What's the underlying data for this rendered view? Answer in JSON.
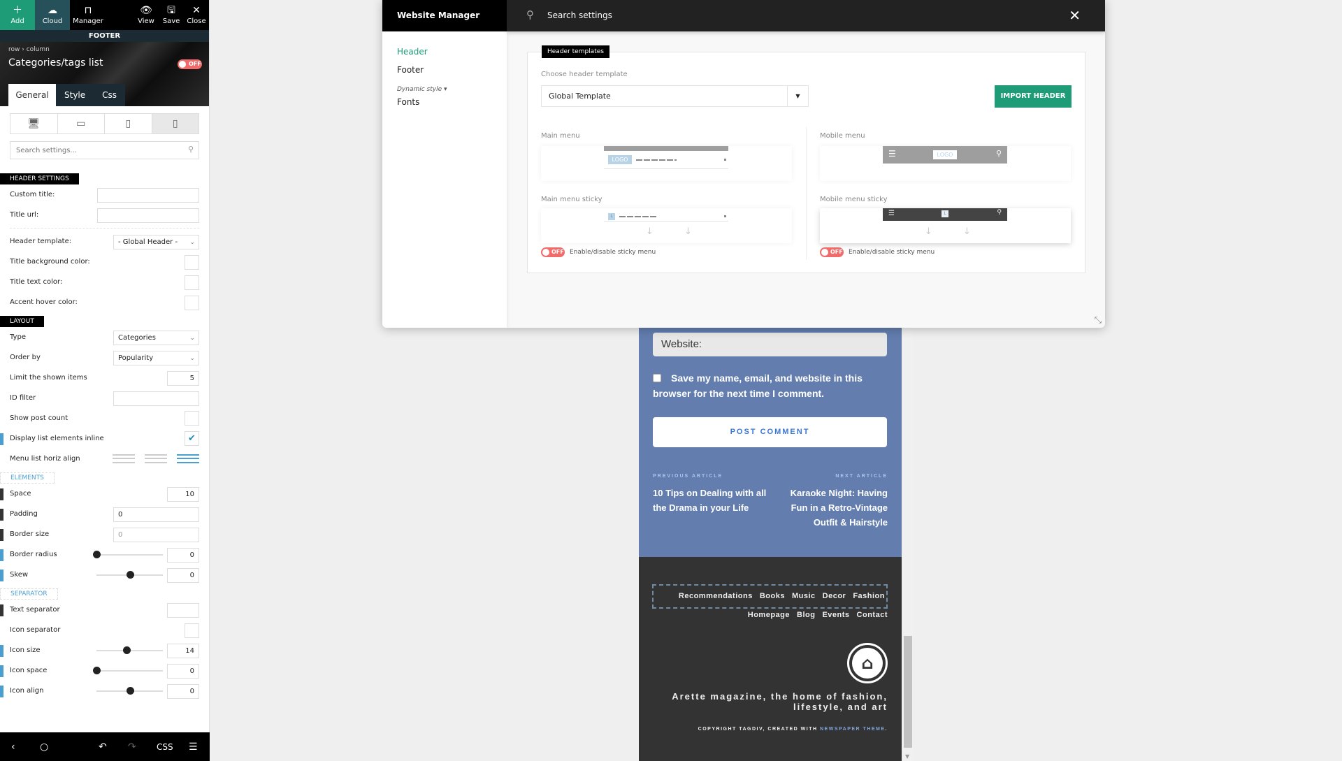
{
  "sidebar": {
    "toolbar": {
      "add": "Add",
      "cloud": "Cloud",
      "manager": "Manager",
      "view": "View",
      "save": "Save",
      "close": "Close"
    },
    "section_bar": "FOOTER",
    "breadcrumb": [
      "row",
      "column"
    ],
    "element_title": "Categories/tags list",
    "toggle_state": "OFF",
    "tabs": [
      "General",
      "Style",
      "Css"
    ],
    "active_tab": "General",
    "devices": [
      "desktop",
      "landscape-tablet",
      "portrait-tablet",
      "phone"
    ],
    "active_device": "phone",
    "search_placeholder": "Search settings...",
    "header_settings": {
      "title": "HEADER SETTINGS",
      "custom_title_label": "Custom title:",
      "custom_title_value": "",
      "title_url_label": "Title url:",
      "title_url_value": "",
      "header_template_label": "Header template:",
      "header_template_value": "- Global Header -",
      "title_bg_color_label": "Title background color:",
      "title_text_color_label": "Title text color:",
      "accent_hover_color_label": "Accent hover color:"
    },
    "layout": {
      "title": "LAYOUT",
      "type_label": "Type",
      "type_value": "Categories",
      "order_label": "Order by",
      "order_value": "Popularity",
      "limit_label": "Limit the shown items",
      "limit_value": "5",
      "id_filter_label": "ID filter",
      "id_filter_value": "",
      "post_count_label": "Show post count",
      "post_count_checked": false,
      "inline_label": "Display list elements inline",
      "inline_checked": true,
      "align_label": "Menu list horiz align",
      "align_value": "right"
    },
    "elements": {
      "title": "ELEMENTS",
      "space_label": "Space",
      "space_value": "10",
      "padding_label": "Padding",
      "padding_value": "0",
      "border_size_label": "Border size",
      "border_size_placeholder": "0",
      "border_radius_label": "Border radius",
      "border_radius_value": "0",
      "border_radius_slider": 0.0,
      "skew_label": "Skew",
      "skew_value": "0",
      "skew_slider": 0.5
    },
    "separator": {
      "title": "SEPARATOR",
      "text_sep_label": "Text separator",
      "text_sep_value": "",
      "icon_sep_label": "Icon separator",
      "icon_size_label": "Icon size",
      "icon_size_value": "14",
      "icon_size_slider": 0.45,
      "icon_space_label": "Icon space",
      "icon_space_value": "0",
      "icon_space_slider": 0.0,
      "icon_align_label": "Icon align",
      "icon_align_value": "0",
      "icon_align_slider": 0.5
    },
    "bottom_bar": {
      "css_label": "CSS"
    }
  },
  "modal": {
    "brand": "Website Manager",
    "search_placeholder": "Search settings",
    "nav": {
      "header": "Header",
      "footer": "Footer",
      "dynamic_style": "Dynamic style",
      "fonts": "Fonts"
    },
    "panel_tag": "Header templates",
    "choose_label": "Choose header template",
    "template_value": "Global Template",
    "import_button": "IMPORT HEADER",
    "main_menu_label": "Main menu",
    "mobile_menu_label": "Mobile menu",
    "main_sticky_label": "Main menu sticky",
    "mobile_sticky_label": "Mobile menu sticky",
    "logo_text": "LOGO",
    "logo_short": "L",
    "sticky_toggle_state": "OFF",
    "sticky_toggle_label": "Enable/disable sticky menu"
  },
  "preview": {
    "website_placeholder": "Website:",
    "save_info_text": "Save my name, email, and website in this browser for the next time I comment.",
    "post_comment": "POST COMMENT",
    "previous_label": "PREVIOUS ARTICLE",
    "previous_title": "10 Tips on Dealing with all the Drama in your Life",
    "next_label": "NEXT ARTICLE",
    "next_title": "Karaoke Night: Having Fun in a Retro-Vintage Outfit & Hairstyle",
    "footer_categories": [
      "Recommendations",
      "Books",
      "Music",
      "Decor",
      "Fashion"
    ],
    "footer_pages": [
      "Homepage",
      "Blog",
      "Events",
      "Contact"
    ],
    "tagline": "Arette magazine, the home of fashion, lifestyle, and art",
    "copyright_prefix": "COPYRIGHT TAGDIV, CREATED WITH ",
    "copyright_link": "NEWSPAPER THEME",
    "copyright_suffix": ".",
    "colors": {
      "blue_bg": "#627dae",
      "dark_bg": "#333333",
      "accent_green": "#1e9c78",
      "toggle_red": "#f26b6b",
      "link_blue": "#3b77d8"
    }
  }
}
